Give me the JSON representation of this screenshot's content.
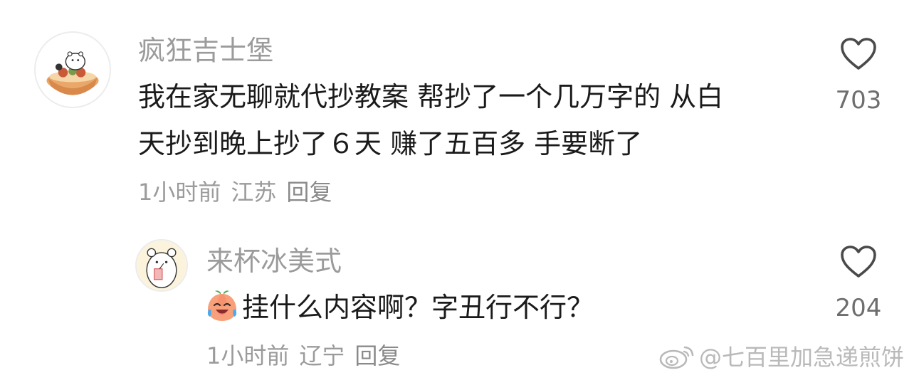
{
  "comments": [
    {
      "username": "疯狂吉士堡",
      "text_line1": "我在家无聊就代抄教案 帮抄了一个几万字的 从白",
      "text_line2": "天抄到晚上抄了６天 赚了五百多 手要断了",
      "time": "1小时前",
      "location": "江苏",
      "reply_label": "回复",
      "likes": "703"
    },
    {
      "username": "来杯冰美式",
      "text_line1": "挂什么内容啊？字丑行不行？",
      "time": "1小时前",
      "location": "辽宁",
      "reply_label": "回复",
      "likes": "204"
    }
  ],
  "watermark": "@七百里加急递煎饼",
  "icons": {
    "like": "heart-outline-icon",
    "emoji": "crying-laughing-peach-emoji",
    "watermark_logo": "weibo-logo"
  },
  "colors": {
    "username": "#9b9b9b",
    "text": "#1a1a1a",
    "meta": "#9b9b9b",
    "watermark": "#b9b9b9"
  }
}
